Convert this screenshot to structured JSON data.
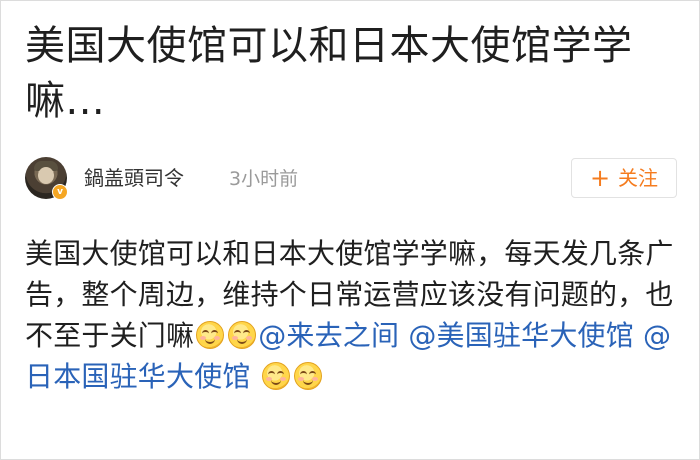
{
  "post": {
    "title": "美国大使馆可以和日本大使馆学学嘛...",
    "author": {
      "name": "鍋盖頭司令",
      "time": "3小时前",
      "avatar_badge": "v"
    },
    "follow_button": {
      "plus": "+",
      "label": "关注"
    },
    "body": {
      "text": "美国大使馆可以和日本大使馆学学嘛，每天发几条广告，整个周边，维持个日常运营应该没有问题的，也不至于关门嘛",
      "mention_1": "@来去之间",
      "mention_2": "@美国驻华大使馆",
      "mention_3": "@日本国驻华大使馆"
    }
  },
  "icons": {
    "avatar": "avatar-icon",
    "verification_badge": "verified-badge-icon",
    "follow_plus": "plus-icon",
    "emoji": "smiling-face-emoji-icon"
  },
  "colors": {
    "follow_accent": "#f57c1f",
    "mention_link": "#2a63b8",
    "badge": "#f5a623",
    "muted_text": "#9a9a9a"
  }
}
